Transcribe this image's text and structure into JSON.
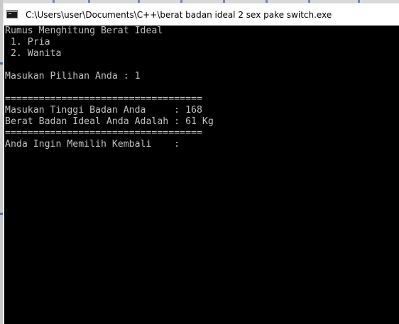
{
  "window": {
    "title": "C:\\Users\\user\\Documents\\C++\\berat badan ideal 2 sex pake switch.exe",
    "icon": "console-app-icon"
  },
  "console": {
    "text_color": "#c0c0c0",
    "background": "#000000",
    "lines": [
      "Rumus Menghitung Berat Ideal",
      " 1. Pria",
      " 2. Wanita",
      "",
      "Masukan Pilihan Anda : 1",
      "",
      "===================================",
      "Masukan Tinggi Badan Anda     : 168",
      "Berat Badan Ideal Anda Adalah : 61 Kg",
      "===================================",
      "Anda Ingin Memilih Kembali    :"
    ]
  }
}
